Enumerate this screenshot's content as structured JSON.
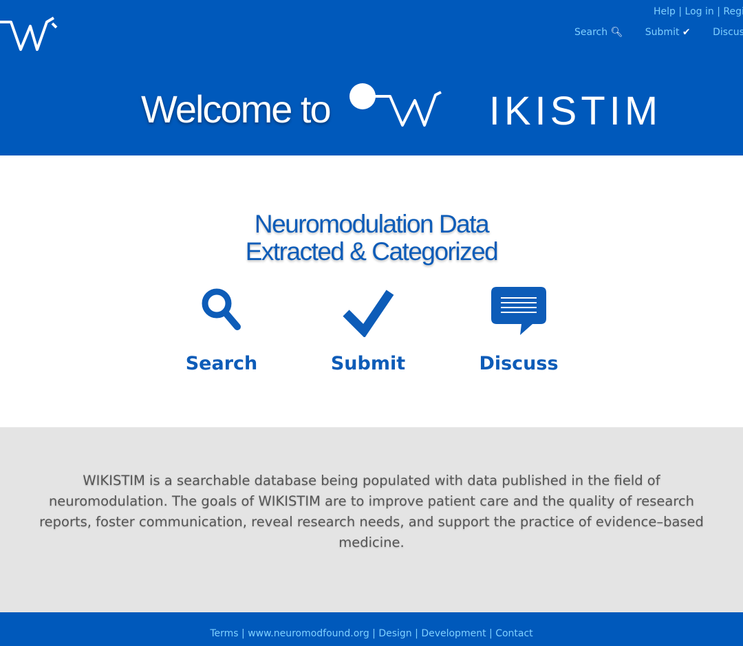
{
  "header": {
    "top_links": [
      "Help",
      "Log in",
      "Register"
    ],
    "nav": [
      {
        "label": "Search",
        "icon": "search-icon"
      },
      {
        "label": "Submit",
        "icon": "check-icon"
      },
      {
        "label": "Discuss",
        "icon": "speech-bubble-icon"
      }
    ],
    "welcome": "Welcome to",
    "brand": "WIKISTIM"
  },
  "main": {
    "tagline_line1": "Neuromodulation Data",
    "tagline_line2": "Extracted & Categorized",
    "features": [
      {
        "label": "Search",
        "icon": "search-icon"
      },
      {
        "label": "Submit",
        "icon": "check-icon"
      },
      {
        "label": "Discuss",
        "icon": "speech-bubble-icon"
      }
    ]
  },
  "about": {
    "text": "WIKISTIM is a searchable database being populated with data published in the field of neuromodulation. The goals of WIKISTIM are to improve patient care and the quality of research reports, foster communication, reveal research needs, and support the practice of evidence–based medicine."
  },
  "footer": {
    "links": [
      "Terms",
      "www.neuromodfound.org",
      "Design",
      "Development",
      "Contact"
    ]
  },
  "colors": {
    "brand_blue": "#0059bb",
    "link_light": "#7fd0ff",
    "heading_blue": "#0d5cb8",
    "about_bg": "#e4e4e4"
  }
}
